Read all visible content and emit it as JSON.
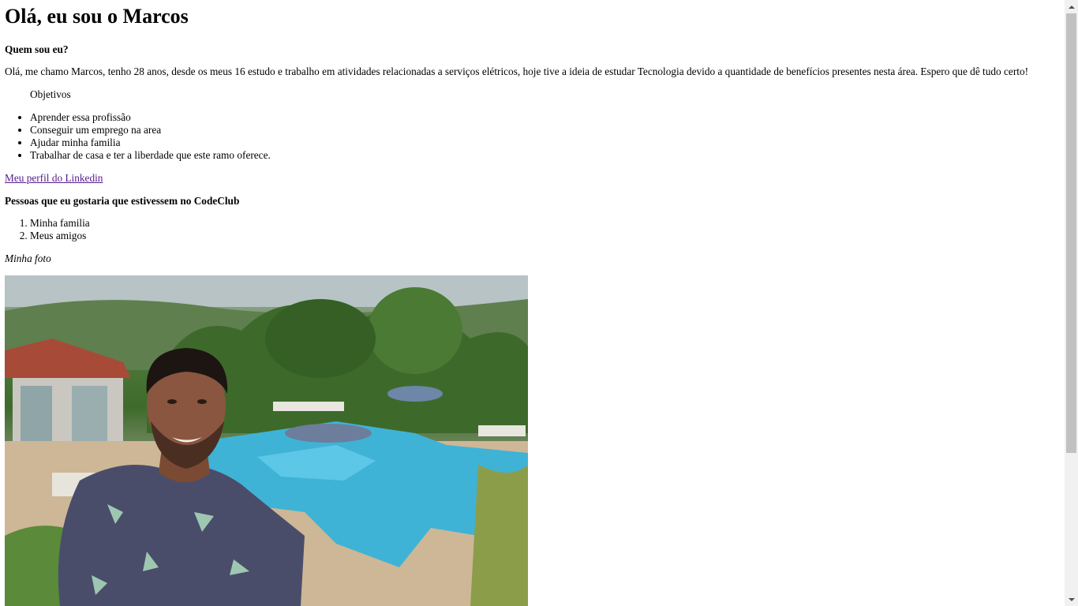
{
  "heading": "Olá, eu sou o Marcos",
  "about": {
    "title": "Quem sou eu?",
    "text": "Olá, me chamo Marcos, tenho 28 anos, desde os meus 16 estudo e trabalho em atividades relacionadas a serviços elétricos, hoje tive a ideia de estudar Tecnologia devido a quantidade de benefícios presentes nesta área. Espero que dê tudo certo!"
  },
  "objectives": {
    "title": "Objetivos",
    "items": [
      "Aprender essa profissão",
      "Conseguir um emprego na area",
      "Ajudar minha familia",
      "Trabalhar de casa e ter a liberdade que este ramo oferece."
    ]
  },
  "linkedin_link": "Meu perfil do Linkedin",
  "people": {
    "title": "Pessoas que eu gostaria que estivessem no CodeClub",
    "items": [
      "Minha familia",
      "Meus amigos"
    ]
  },
  "photo_caption": "Minha foto",
  "colors": {
    "link_visited": "#551a8b",
    "pool": "#3fb3d6",
    "shirt": "#4a4d6a"
  }
}
